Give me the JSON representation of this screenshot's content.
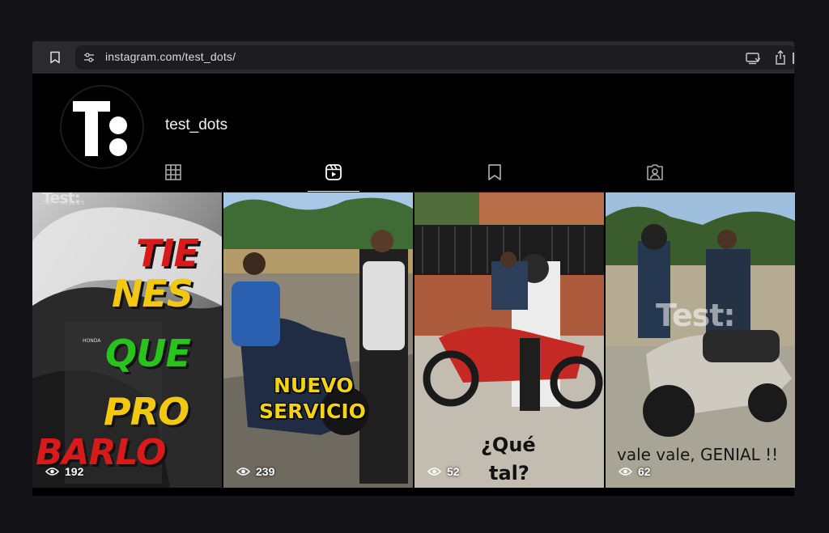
{
  "browser": {
    "url": "instagram.com/test_dots/"
  },
  "profile": {
    "username": "test_dots",
    "avatar_letter": "T"
  },
  "tabs": [
    {
      "icon": "grid-icon",
      "active": false
    },
    {
      "icon": "reels-icon",
      "active": true
    },
    {
      "icon": "bookmark-icon",
      "active": false
    },
    {
      "icon": "tagged-icon",
      "active": false
    }
  ],
  "reels": [
    {
      "views": "192",
      "corner_brand": "Test:",
      "corner_stamp": "TDP - 10/12/25",
      "rider_patch": "HONDA",
      "overlay_lines": [
        "TIE",
        "NES",
        "QUE",
        "PRO",
        "BARLO"
      ],
      "overlay_colors": [
        "#d91a1a",
        "#f2c811",
        "#27c41c",
        "#f2c811",
        "#d91a1a"
      ]
    },
    {
      "views": "239",
      "overlay_lines": [
        "NUEVO",
        "SERVICIO"
      ],
      "overlay_color": "#f4d313"
    },
    {
      "views": "52",
      "overlay_lines": [
        "¿Qué",
        "tal?"
      ]
    },
    {
      "views": "62",
      "watermark": "Test:",
      "caption": "vale vale, GENIAL !!"
    }
  ]
}
